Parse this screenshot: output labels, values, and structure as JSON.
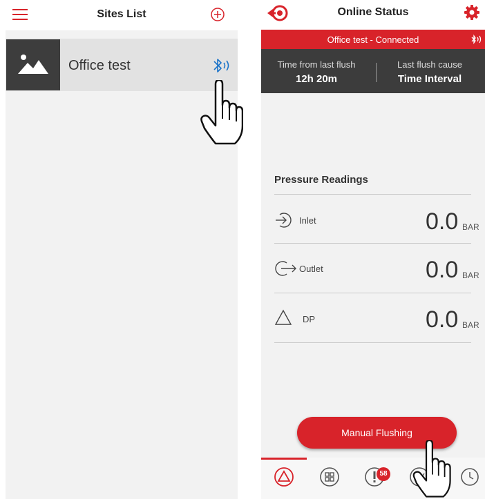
{
  "sites_screen": {
    "title": "Sites List",
    "sites": [
      {
        "name": "Office test"
      }
    ]
  },
  "status_screen": {
    "title": "Online Status",
    "connection_text": "Office test - Connected",
    "flush": {
      "time_label": "Time from last flush",
      "time_value": "12h 20m",
      "cause_label": "Last flush cause",
      "cause_value": "Time Interval"
    },
    "pressure": {
      "title": "Pressure Readings",
      "rows": [
        {
          "label": "Inlet",
          "value": "0.0",
          "unit": "BAR"
        },
        {
          "label": "Outlet",
          "value": "0.0",
          "unit": "BAR"
        },
        {
          "label": "DP",
          "value": "0.0",
          "unit": "BAR"
        }
      ]
    },
    "manual_button": "Manual Flushing",
    "alerts_badge": "58"
  },
  "colors": {
    "accent": "#d8232a",
    "dark_bar": "#3c3c3c",
    "bluetooth": "#1a73c9",
    "background": "#f2f2f2"
  },
  "icons": [
    "menu-icon",
    "add-circle-icon",
    "image-icon",
    "bluetooth-icon",
    "back-target-icon",
    "gear-icon",
    "inlet-icon",
    "outlet-icon",
    "delta-icon",
    "hand-pointer-icon",
    "dashboard-tab-icon",
    "grid-tab-icon",
    "alert-tab-icon",
    "chart-tab-icon",
    "history-tab-icon"
  ]
}
